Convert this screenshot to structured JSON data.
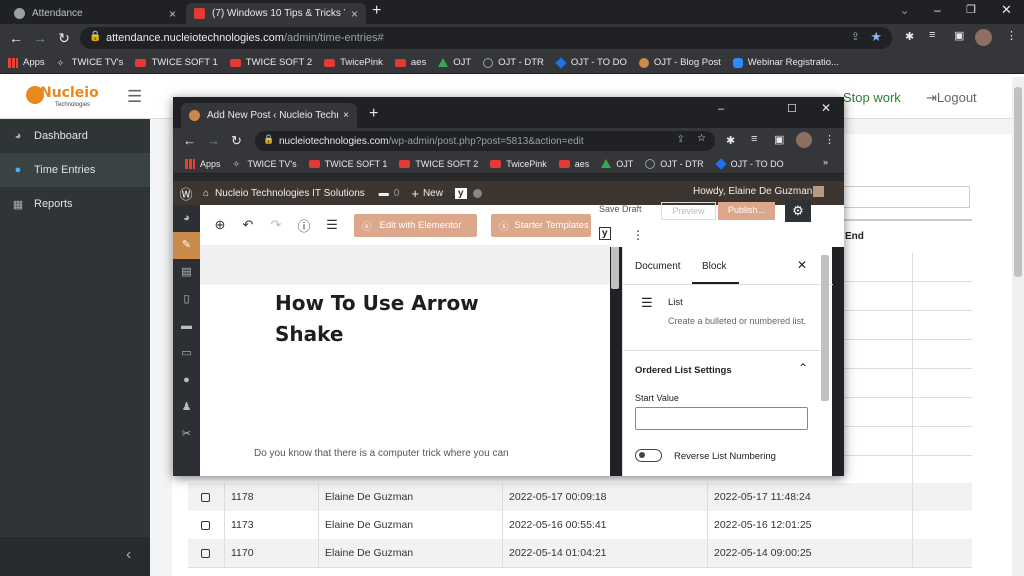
{
  "browser": {
    "tabs": [
      {
        "title": "Attendance",
        "active": false
      },
      {
        "title": "(7) Windows 10 Tips & Tricks You",
        "active": true
      }
    ],
    "url_host": "attendance.nucleiotechnologies.com",
    "url_path": "/admin/time-entries#",
    "bookmarks": [
      "Apps",
      "TWICE TV's",
      "TWICE SOFT 1",
      "TWICE SOFT 2",
      "TwicePink",
      "aes",
      "OJT",
      "OJT - DTR",
      "OJT - TO DO",
      "OJT - Blog Post",
      "Webinar Registratio..."
    ]
  },
  "app": {
    "logo": "Nucleio",
    "logo_sub": "Technologies",
    "stop_work": "Stop work",
    "logout": "Logout",
    "sidebar": [
      {
        "label": "Dashboard",
        "icon": "dashboard-icon"
      },
      {
        "label": "Time Entries",
        "icon": "clock-icon"
      },
      {
        "label": "Reports",
        "icon": "calendar-icon"
      }
    ],
    "table_header_end": "End",
    "rows": [
      {
        "id": "1178",
        "name": "Elaine De Guzman",
        "start": "2022-05-17 00:09:18",
        "end": "2022-05-17 11:48:24"
      },
      {
        "id": "1173",
        "name": "Elaine De Guzman",
        "start": "2022-05-16 00:55:41",
        "end": "2022-05-16 12:01:25"
      },
      {
        "id": "1170",
        "name": "Elaine De Guzman",
        "start": "2022-05-14 01:04:21",
        "end": "2022-05-14 09:00:25"
      }
    ],
    "collapse": "‹"
  },
  "popup": {
    "tab_title": "Add New Post ‹ Nucleio Technolo",
    "url_host": "nucleiotechnologies.com",
    "url_path": "/wp-admin/post.php?post=5813&action=edit",
    "bookmarks": [
      "Apps",
      "TWICE TV's",
      "TWICE SOFT 1",
      "TWICE SOFT 2",
      "TwicePink",
      "aes",
      "OJT",
      "OJT - DTR",
      "OJT - TO DO"
    ],
    "wp": {
      "site": "Nucleio Technologies IT Solutions",
      "comments": "0",
      "new": "New",
      "howdy": "Howdy, Elaine De Guzman",
      "save_draft": "Save Draft",
      "preview": "Preview",
      "publish": "Publish...",
      "edit_elementor": "Edit with Elementor",
      "starter_templates": "Starter Templates",
      "post_title_line1": "How To Use Arrow",
      "post_title_line2": "Shake",
      "paragraph": "Do you know that there is a computer trick where you can",
      "tab_document": "Document",
      "tab_block": "Block",
      "block_name": "List",
      "block_desc": "Create a bulleted or numbered list.",
      "ordered_settings": "Ordered List Settings",
      "start_value_label": "Start Value",
      "start_value": "",
      "reverse_label": "Reverse List Numbering"
    }
  }
}
